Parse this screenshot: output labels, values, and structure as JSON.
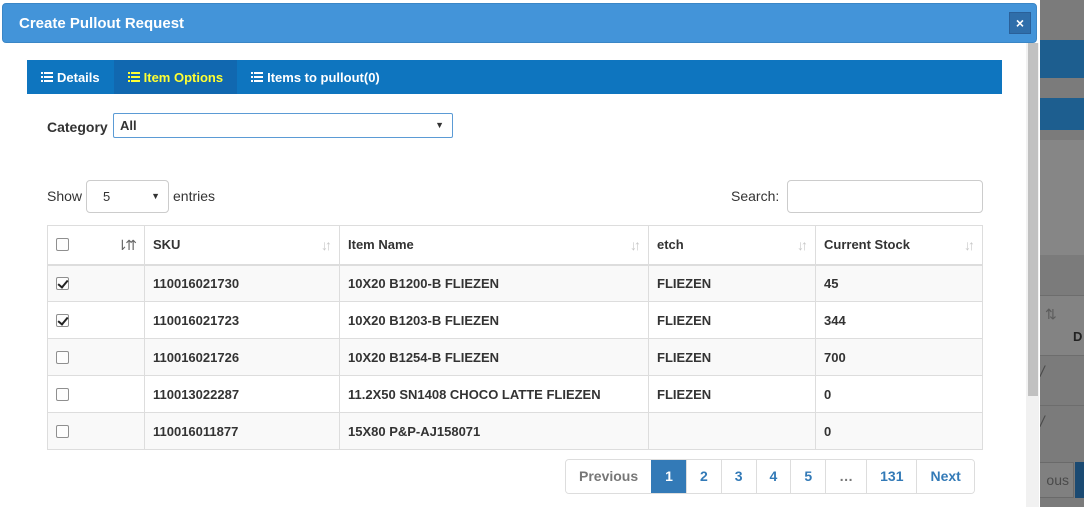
{
  "modal": {
    "title": "Create Pullout Request",
    "close_label": "×"
  },
  "tabs": [
    {
      "label": "Details",
      "active": false
    },
    {
      "label": "Item Options",
      "active": true
    },
    {
      "label": "Items to pullout(0)",
      "active": false
    }
  ],
  "category": {
    "label": "Category",
    "selected": "All"
  },
  "entries": {
    "show_label": "Show",
    "selected": "5",
    "suffix_label": "entries"
  },
  "search": {
    "label": "Search:",
    "value": "",
    "placeholder": ""
  },
  "table": {
    "columns": [
      "",
      "SKU",
      "Item Name",
      "etch",
      "Current Stock"
    ],
    "rows": [
      {
        "checked": true,
        "sku": "110016021730",
        "name": "10X20 B1200-B FLIEZEN",
        "etch": "FLIEZEN",
        "stock": "45"
      },
      {
        "checked": true,
        "sku": "110016021723",
        "name": "10X20 B1203-B FLIEZEN",
        "etch": "FLIEZEN",
        "stock": "344"
      },
      {
        "checked": false,
        "sku": "110016021726",
        "name": "10X20 B1254-B FLIEZEN",
        "etch": "FLIEZEN",
        "stock": "700"
      },
      {
        "checked": false,
        "sku": "110013022287",
        "name": "11.2X50 SN1408 CHOCO LATTE FLIEZEN",
        "etch": "FLIEZEN",
        "stock": "0"
      },
      {
        "checked": false,
        "sku": "110016011877",
        "name": "15X80 P&P-AJ158071",
        "etch": "",
        "stock": "0"
      }
    ]
  },
  "pagination": {
    "previous": "Previous",
    "pages": [
      "1",
      "2",
      "3",
      "4",
      "5",
      "…",
      "131"
    ],
    "current": "1",
    "next": "Next"
  },
  "background": {
    "header_letter": "D",
    "pager_text": "ous"
  },
  "colors": {
    "header": "#4394d9",
    "tabs": "#0e75bf",
    "active_tab_text": "#ffff33",
    "pager_active": "#337ab7"
  }
}
